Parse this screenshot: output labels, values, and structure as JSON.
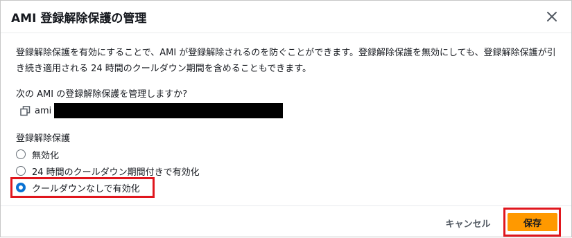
{
  "dialog": {
    "title": "AMI 登録解除保護の管理",
    "description": "登録解除保護を有効にすることで、AMI が登録解除されるのを防ぐことができます。登録解除保護を無効にしても、登録解除保護が引き続き適用される 24 時間のクールダウン期間を含めることもできます。",
    "question": "次の AMI の登録解除保護を管理しますか?",
    "ami_prefix": "ami",
    "group_label": "登録解除保護",
    "options": [
      {
        "label": "無効化",
        "checked": false
      },
      {
        "label": "24 時間のクールダウン期間付きで有効化",
        "checked": false
      },
      {
        "label": "クールダウンなしで有効化",
        "checked": true
      }
    ],
    "cancel_label": "キャンセル",
    "save_label": "保存"
  },
  "icons": {
    "close": "close-icon",
    "copy": "copy-icon"
  },
  "colors": {
    "primary_button": "#ff9900",
    "radio_selected": "#0972d3",
    "highlight": "#e0161d"
  }
}
